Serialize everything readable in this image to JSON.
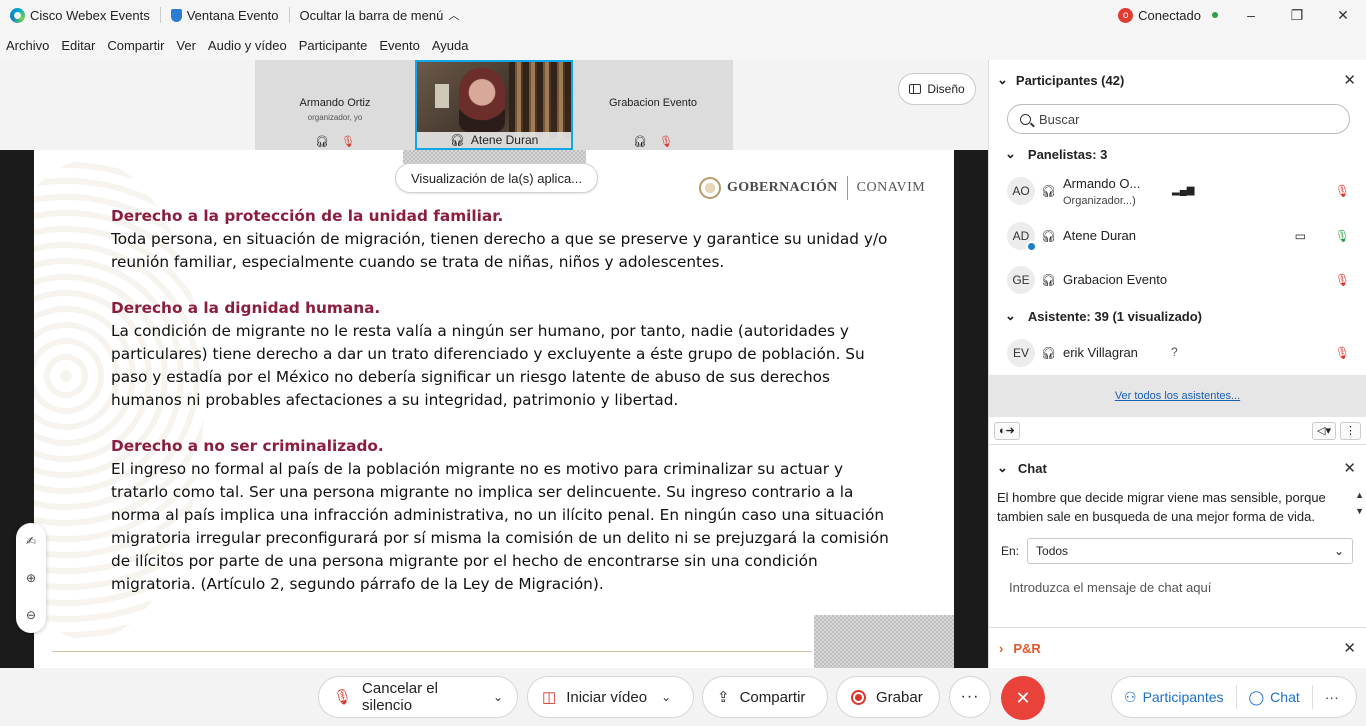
{
  "titlebar": {
    "app_name": "Cisco Webex Events",
    "window_label": "Ventana Evento",
    "hide_menu_label": "Ocultar la barra de menú",
    "status": "Conectado"
  },
  "menu": [
    "Archivo",
    "Editar",
    "Compartir",
    "Ver",
    "Audio y vídeo",
    "Participante",
    "Evento",
    "Ayuda"
  ],
  "video_strip": {
    "tiles": [
      {
        "name": "Armando Ortiz",
        "sub": "organizador, yo"
      },
      {
        "name": "Atene Duran"
      },
      {
        "name": "Grabacion Evento"
      }
    ],
    "layout_label": "Diseño"
  },
  "share_pill": "Visualización de la(s) aplica...",
  "slide": {
    "logo_left": "GOBERNACIÓN",
    "logo_right": "CONAVIM",
    "sections": [
      {
        "title": "Derecho a la protección de la unidad familiar.",
        "body": "Toda persona, en situación de migración, tienen derecho a que se preserve y garantice su unidad y/o reunión familiar, especialmente cuando se trata de niñas, niños y adolescentes."
      },
      {
        "title": "Derecho a la dignidad humana.",
        "body": "La condición de migrante no le resta valía a ningún ser humano, por tanto, nadie (autoridades y particulares) tiene derecho a dar un trato diferenciado y excluyente a éste grupo de población. Su paso y estadía por el México no debería significar un riesgo latente de abuso de sus derechos humanos ni probables afectaciones a su integridad, patrimonio y libertad."
      },
      {
        "title": "Derecho a no ser criminalizado.",
        "body": "El ingreso no formal al país de la población migrante no es motivo para criminalizar su actuar y tratarlo como tal. Ser una persona migrante no implica ser delincuente. Su ingreso contrario a la norma al país implica una infracción administrativa, no un ilícito penal. En ningún caso una situación migratoria irregular preconfigurará por sí misma la comisión de un delito ni se prejuzgará la comisión de ilícitos por parte de una persona migrante por el hecho de encontrarse sin una condición migratoria. (Artículo 2, segundo párrafo de la Ley de Migración)."
      }
    ]
  },
  "participants": {
    "title": "Participantes (42)",
    "search_placeholder": "Buscar",
    "panelists_label": "Panelistas: 3",
    "panelists": [
      {
        "initials": "AO",
        "name": "Armando O...",
        "sub": "Organizador...)"
      },
      {
        "initials": "AD",
        "name": "Atene Duran"
      },
      {
        "initials": "GE",
        "name": "Grabacion Evento"
      }
    ],
    "attendees_label": "Asistente: 39 (1 visualizado)",
    "attendees": [
      {
        "initials": "EV",
        "name": "erik Villagran",
        "status": "?"
      }
    ],
    "see_all": "Ver todos los asistentes..."
  },
  "chat": {
    "title": "Chat",
    "message": "El hombre que decide migrar viene mas sensible, porque tambien sale en busqueda de una mejor forma de vida.",
    "to_label": "En:",
    "to_value": "Todos",
    "input_placeholder": "Introduzca el mensaje de chat aquí"
  },
  "qa": {
    "title": "P&R"
  },
  "controls": {
    "mute": "Cancelar el silencio",
    "video": "Iniciar vídeo",
    "share": "Compartir",
    "record": "Grabar",
    "participants": "Participantes",
    "chat": "Chat"
  },
  "colors": {
    "accent": "#11a6e8",
    "slide_heading": "#8b1d3d",
    "leave": "#e8423a"
  }
}
